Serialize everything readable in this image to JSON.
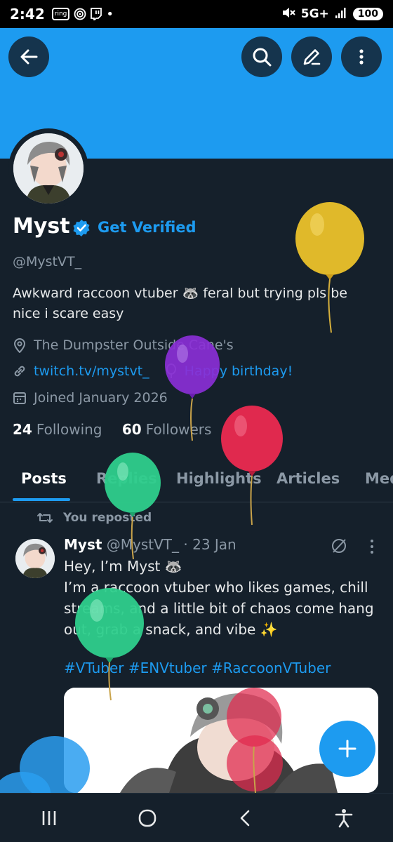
{
  "status_bar": {
    "time": "2:42",
    "icons": [
      "ring-icon",
      "target-icon",
      "twitch-icon",
      "dot-icon"
    ],
    "ring_label": "ring",
    "network": "5G+",
    "battery": "100"
  },
  "header": {
    "back_icon": "back-arrow-icon",
    "search_icon": "search-icon",
    "edit_icon": "pencil-icon",
    "more_icon": "more-vertical-icon",
    "banner_color": "#1d9bf0"
  },
  "profile": {
    "name": "Myst",
    "verified_icon": "verified-badge-icon",
    "get_verified": "Get Verified",
    "handle": "@MystVT_",
    "bio": "Awkward raccoon vtuber 🦝 feral but trying pls be nice i scare easy",
    "location": "The Dumpster Outside Cane's",
    "website": "twitch.tv/mystvt_",
    "birthday": "Happy birthday!",
    "joined": "Joined January 2026",
    "following_count": "24",
    "following_label": "Following",
    "followers_count": "60",
    "followers_label": "Followers"
  },
  "tabs": [
    "Posts",
    "Replies",
    "Highlights",
    "Articles",
    "Med"
  ],
  "active_tab": "Posts",
  "post": {
    "repost_label": "You reposted",
    "author": "Myst",
    "handle_date": "@MystVT_ · 23 Jan",
    "line1": "Hey, I’m Myst 🦝",
    "body": "I’m a raccoon vtuber who likes games, chill streams, and a little bit of chaos come hang out, grab a snack, and vibe ✨",
    "hashtags": "#VTuber #ENVtuber #RaccoonVTuber"
  },
  "fab_icon": "plus-icon",
  "nav_bar": [
    "recent-apps-icon",
    "home-icon",
    "back-icon",
    "accessibility-icon"
  ],
  "colors": {
    "accent": "#1d9bf0",
    "background": "#15202b",
    "muted": "#8b98a5"
  }
}
